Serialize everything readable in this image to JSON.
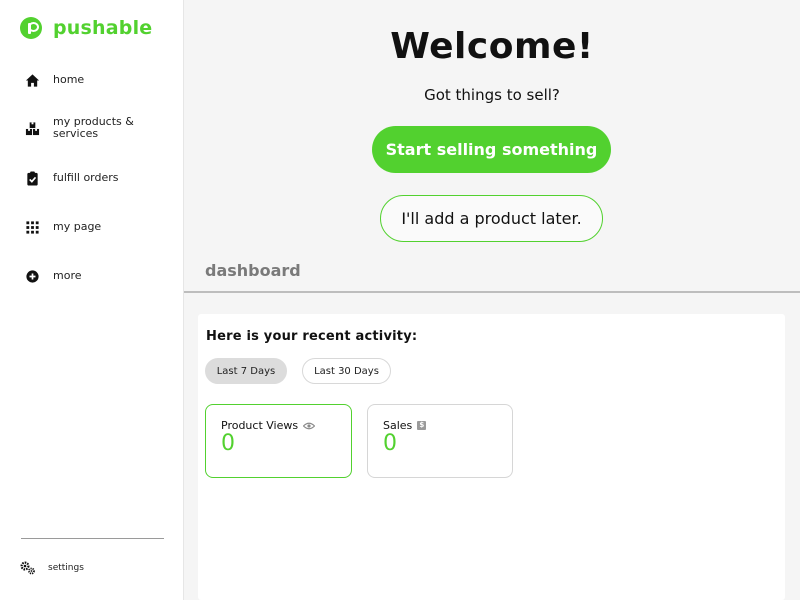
{
  "brand": {
    "name": "pushable",
    "color": "#52d12f"
  },
  "sidebar": {
    "items": [
      {
        "label": "home",
        "icon": "home-icon"
      },
      {
        "label": "my products & services",
        "icon": "boxes-icon"
      },
      {
        "label": "fulfill orders",
        "icon": "clipboard-check-icon"
      },
      {
        "label": "my page",
        "icon": "grid-icon"
      },
      {
        "label": "more",
        "icon": "plus-circle-icon"
      }
    ],
    "settings_label": "settings"
  },
  "main": {
    "welcome_title": "Welcome!",
    "welcome_subtitle": "Got things to sell?",
    "primary_button": "Start selling something",
    "secondary_button": "I'll add a product later.",
    "dashboard_heading": "dashboard"
  },
  "activity": {
    "title": "Here is your recent activity:",
    "ranges": [
      {
        "label": "Last 7 Days",
        "active": true
      },
      {
        "label": "Last 30 Days",
        "active": false
      }
    ],
    "stats": [
      {
        "label": "Product Views",
        "value": "0",
        "icon": "eye-icon"
      },
      {
        "label": "Sales",
        "value": "0",
        "icon": "dollar-icon"
      }
    ]
  }
}
